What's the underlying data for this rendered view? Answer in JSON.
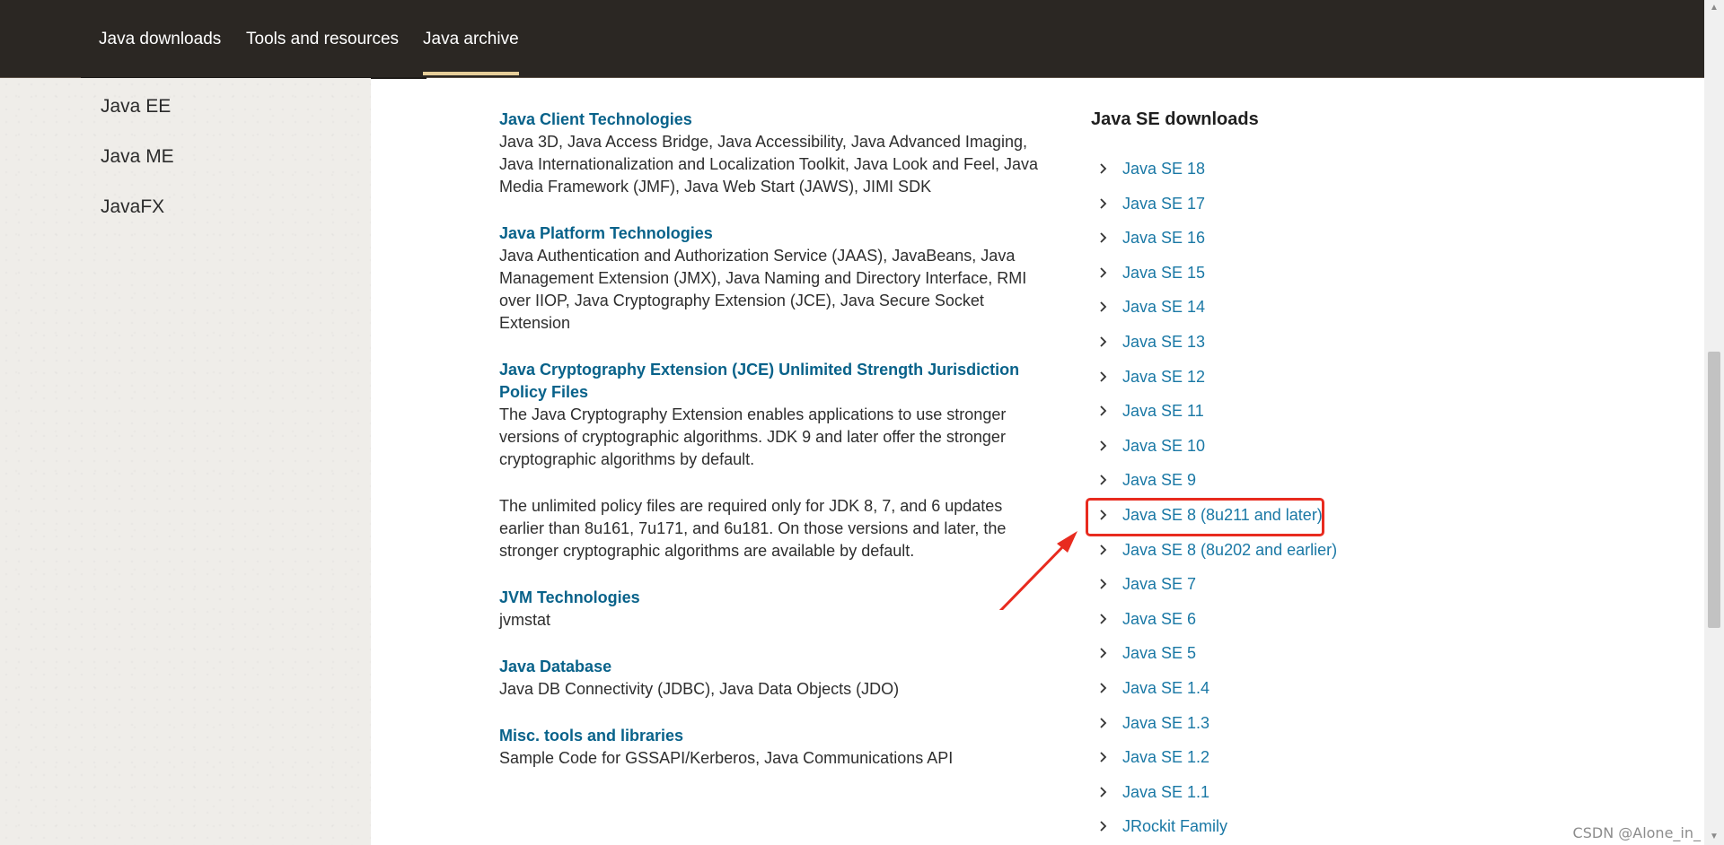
{
  "topnav": {
    "tabs": [
      {
        "label": "Java downloads",
        "active": false
      },
      {
        "label": "Tools and resources",
        "active": false
      },
      {
        "label": "Java archive",
        "active": true
      }
    ]
  },
  "sidebar": {
    "items": [
      "Java EE",
      "Java ME",
      "JavaFX"
    ]
  },
  "main": {
    "sections": [
      {
        "title": "Java Client Technologies",
        "desc": [
          "Java 3D, Java Access Bridge, Java Accessibility, Java Advanced Imaging,",
          "Java Internationalization and Localization Toolkit, Java Look and Feel, Java",
          "Media Framework (JMF), Java Web Start (JAWS), JIMI SDK"
        ]
      },
      {
        "title": "Java Platform Technologies",
        "desc": [
          "Java Authentication and Authorization Service (JAAS), JavaBeans, Java",
          "Management Extension (JMX), Java Naming and Directory Interface, RMI",
          "over IIOP, Java Cryptography Extension (JCE), Java Secure Socket",
          "Extension"
        ]
      },
      {
        "title_lines": [
          "Java Cryptography Extension (JCE) Unlimited Strength Jurisdiction",
          "Policy Files"
        ],
        "desc": [
          "The Java Cryptography Extension enables applications to use stronger",
          "versions of cryptographic algorithms. JDK 9 and later offer the stronger",
          "cryptographic algorithms by default."
        ],
        "desc2": [
          "The unlimited policy files are required only for JDK 8, 7, and 6 updates",
          "earlier than 8u161, 7u171, and 6u181. On those versions and later, the",
          "stronger cryptographic algorithms are available by default."
        ]
      },
      {
        "title": "JVM Technologies",
        "desc": [
          "jvmstat"
        ]
      },
      {
        "title": "Java Database",
        "desc": [
          "Java DB Connectivity (JDBC), Java Data Objects (JDO)"
        ]
      },
      {
        "title": "Misc. tools and libraries",
        "desc": [
          "Sample Code for GSSAPI/Kerberos, Java Communications API"
        ]
      }
    ]
  },
  "right": {
    "title": "Java SE downloads",
    "items": [
      "Java SE 18",
      "Java SE 17",
      "Java SE 16",
      "Java SE 15",
      "Java SE 14",
      "Java SE 13",
      "Java SE 12",
      "Java SE 11",
      "Java SE 10",
      "Java SE 9",
      "Java SE 8 (8u211 and later)",
      "Java SE 8 (8u202 and earlier)",
      "Java SE 7",
      "Java SE 6",
      "Java SE 5",
      "Java SE 1.4",
      "Java SE 1.3",
      "Java SE 1.2",
      "Java SE 1.1",
      "JRockit Family"
    ],
    "highlighted_index": 10
  },
  "colors": {
    "nav_bg": "#2b2723",
    "nav_active_underline": "#e7cf9a",
    "link": "#1a78a5",
    "section_title": "#08628a",
    "highlight": "#e82b1f"
  },
  "watermark": "CSDN @Alone_in_"
}
